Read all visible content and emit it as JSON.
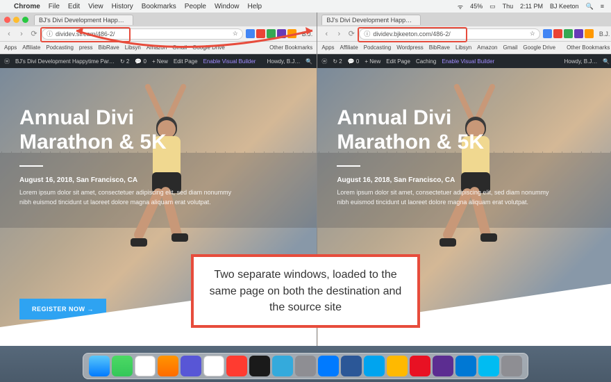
{
  "menubar": {
    "app": "Chrome",
    "items": [
      "File",
      "Edit",
      "View",
      "History",
      "Bookmarks",
      "People",
      "Window",
      "Help"
    ],
    "right": {
      "battery": "45%",
      "day": "Thu",
      "time": "2:11 PM",
      "user": "BJ Keeton"
    }
  },
  "left": {
    "tab_title": "BJ's Divi Development Happ…",
    "url": "dividev.stream/486-2/",
    "bookmarks": [
      "Apps",
      "Affiliate",
      "Podcasting",
      "press",
      "BibRave",
      "Libsyn",
      "Amazon",
      "Gmail",
      "Google Drive",
      "Other Bookmarks"
    ],
    "wpbar": {
      "site": "BJ's Divi Development Happytime Par…",
      "updates": "2",
      "comments": "0",
      "new": "+ New",
      "edit": "Edit Page",
      "vb": "Enable Visual Builder",
      "howdy": "Howdy, B.J…"
    },
    "hero": {
      "title_l1": "Annual Divi",
      "title_l2": "Marathon & 5K",
      "date": "August 16, 2018, San Francisco, CA",
      "lorem": "Lorem ipsum dolor sit amet, consectetuer adipiscing elit, sed diam nonummy nibh euismod tincidunt ut laoreet dolore magna aliquam erat volutpat.",
      "cta": "REGISTER NOW →"
    }
  },
  "right": {
    "tab_title": "BJ's Divi Development Happ…",
    "url": "dividev.bjkeeton.com/486-2/",
    "bookmarks": [
      "Apps",
      "Affiliate",
      "Podcasting",
      "Wordpress",
      "BibRave",
      "Libsyn",
      "Amazon",
      "Gmail",
      "Google Drive",
      "Other Bookmarks"
    ],
    "wpbar": {
      "site": "",
      "updates": "2",
      "comments": "0",
      "new": "+ New",
      "edit": "Edit Page",
      "caching": "Caching",
      "vb": "Enable Visual Builder",
      "howdy": "Howdy, B.J…"
    },
    "hero": {
      "title_l1": "Annual Divi",
      "title_l2": "Marathon & 5K",
      "date": "August 16, 2018, San Francisco, CA",
      "lorem": "Lorem ipsum dolor sit amet, consectetuer adipiscing elit, sed diam nonummy nibh euismod tincidunt ut laoreet dolore magna aliquam erat volutpat."
    }
  },
  "callout": "Two separate windows, loaded to the same page on both the destination and the source site",
  "user_label": "B.J."
}
